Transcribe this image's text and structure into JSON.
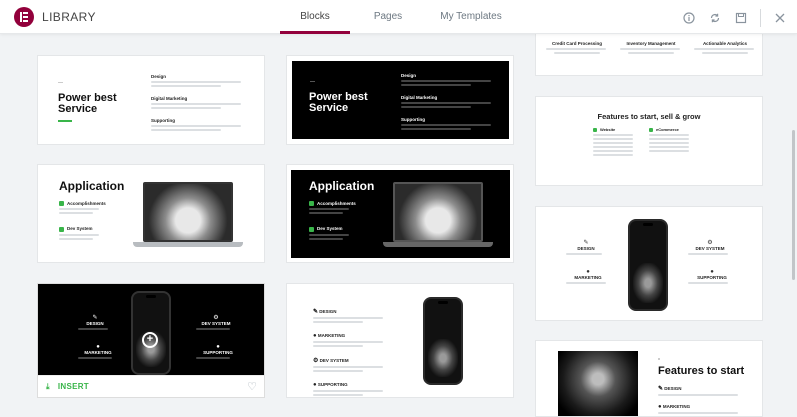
{
  "header": {
    "title": "LIBRARY",
    "tabs": [
      {
        "label": "Blocks",
        "active": true
      },
      {
        "label": "Pages",
        "active": false
      },
      {
        "label": "My Templates",
        "active": false
      }
    ],
    "icons": [
      "info-icon",
      "sync-icon",
      "save-icon",
      "close-icon"
    ],
    "accent_color": "#93003c"
  },
  "cards": {
    "service_light": {
      "title_line1": "Power best",
      "title_line2": "Service",
      "items": [
        "Design",
        "Digital Marketing",
        "Supporting"
      ]
    },
    "service_dark": {
      "title_line1": "Power best",
      "title_line2": "Service",
      "items": [
        "Design",
        "Digital Marketing",
        "Supporting"
      ]
    },
    "app_light": {
      "title": "Application",
      "items": [
        "Accomplishments",
        "Dev System"
      ]
    },
    "app_dark": {
      "title": "Application",
      "items": [
        "Accomplishments",
        "Dev System"
      ]
    },
    "phone_dark": {
      "items": [
        "DESIGN",
        "DEV SYSTEM",
        "MARKETING",
        "SUPPORTING"
      ],
      "insert_label": "INSERT"
    },
    "phone_light_list": {
      "items": [
        "DESIGN",
        "MARKETING",
        "DEV SYSTEM",
        "SUPPORTING"
      ]
    },
    "top_features": {
      "items": [
        "Credit Card Processing",
        "Inventory Management",
        "Actionable Analytics"
      ]
    },
    "features_grow": {
      "title": "Features to start, sell & grow",
      "col1_head": "Website",
      "col2_head": "eCommerce"
    },
    "phone_light": {
      "items": [
        "DESIGN",
        "DEV SYSTEM",
        "MARKETING",
        "SUPPORTING"
      ]
    },
    "features_start": {
      "title": "Features to start",
      "items": [
        "DESIGN",
        "MARKETING"
      ]
    }
  },
  "colors": {
    "green": "#39b54a",
    "brand": "#92003b"
  }
}
